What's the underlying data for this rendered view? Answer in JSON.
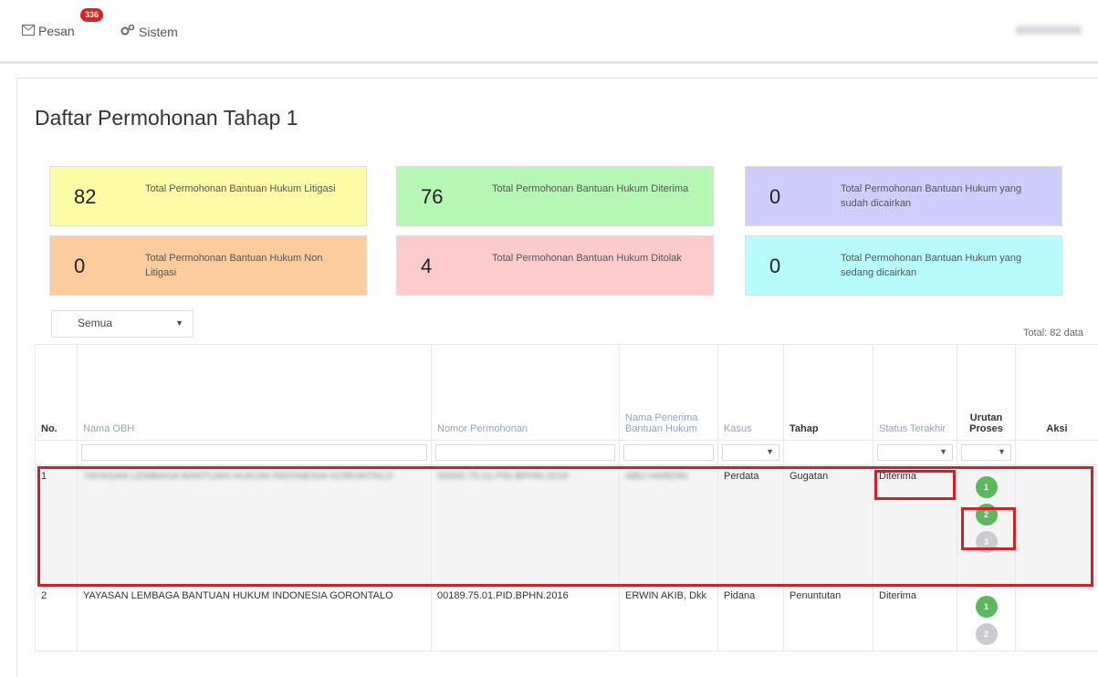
{
  "nav": {
    "pesan_label": "Pesan",
    "pesan_badge": "336",
    "sistem_label": "Sistem"
  },
  "page": {
    "title": "Daftar Permohonan Tahap 1"
  },
  "cards": [
    {
      "value": "82",
      "label": "Total Permohonan Bantuan Hukum Litigasi",
      "color": "#fdfca6"
    },
    {
      "value": "76",
      "label": "Total Permohonan Bantuan Hukum Diterima",
      "color": "#b6f7b5"
    },
    {
      "value": "0",
      "label": "Total Permohonan Bantuan Hukum yang sudah dicairkan",
      "color": "#cfcdfb"
    },
    {
      "value": "0",
      "label": "Total Permohonan Bantuan Hukum Non Litigasi",
      "color": "#fccc9d"
    },
    {
      "value": "4",
      "label": "Total Permohonan Bantuan Hukum Ditolak",
      "color": "#fccccd"
    },
    {
      "value": "0",
      "label": "Total Permohonan Bantuan Hukum yang sedang dicairkan",
      "color": "#b7fbfc"
    }
  ],
  "filter": {
    "selected": "Semua"
  },
  "total_text": "Total: 82 data",
  "table": {
    "headers": {
      "no": "No.",
      "nama_obh": "Nama OBH",
      "nomor": "Nomor Permohonan",
      "penerima": "Nama Penerima Bantuan Hukum",
      "kasus": "Kasus",
      "tahap": "Tahap",
      "status": "Status Terakhir",
      "urutan": "Urutan Proses",
      "aksi": "Aksi"
    },
    "rows": [
      {
        "no": "1",
        "nama_obh": "YAYASAN LEMBAGA BANTUAN HUKUM INDONESIA GORONTALO",
        "nomor": "00000.75.01.PID.BPHN.2016",
        "penerima": "ABU HARDIN",
        "kasus": "Perdata",
        "tahap": "Gugatan",
        "status": "Diterima",
        "steps": [
          "1",
          "2",
          "3"
        ]
      },
      {
        "no": "2",
        "nama_obh": "YAYASAN LEMBAGA BANTUAN HUKUM INDONESIA GORONTALO",
        "nomor": "00189.75.01.PID.BPHN.2016",
        "penerima": "ERWIN AKIB, Dkk",
        "kasus": "Pidana",
        "tahap": "Penuntutan",
        "status": "Diterima",
        "steps": [
          "1",
          "2"
        ]
      }
    ]
  }
}
